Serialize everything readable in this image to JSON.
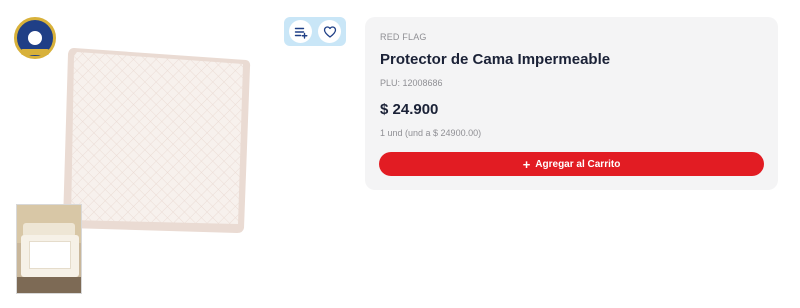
{
  "product": {
    "brand": "RED FLAG",
    "title": "Protector de Cama Impermeable",
    "plu": "PLU: 12008686",
    "price": "$ 24.900",
    "unit_price": "1 und (und a $ 24900.00)"
  },
  "actions": {
    "add_to_cart_label": "Agregar al Carrito",
    "add_to_cart_icon": "plus-icon",
    "add_to_list_icon": "add-to-list-icon",
    "favorite_icon": "heart-icon"
  },
  "colors": {
    "accent_red": "#e21c23",
    "pill_blue": "#c9e6f7",
    "text_dark": "#1b2237",
    "card_bg": "#f4f4f5"
  }
}
